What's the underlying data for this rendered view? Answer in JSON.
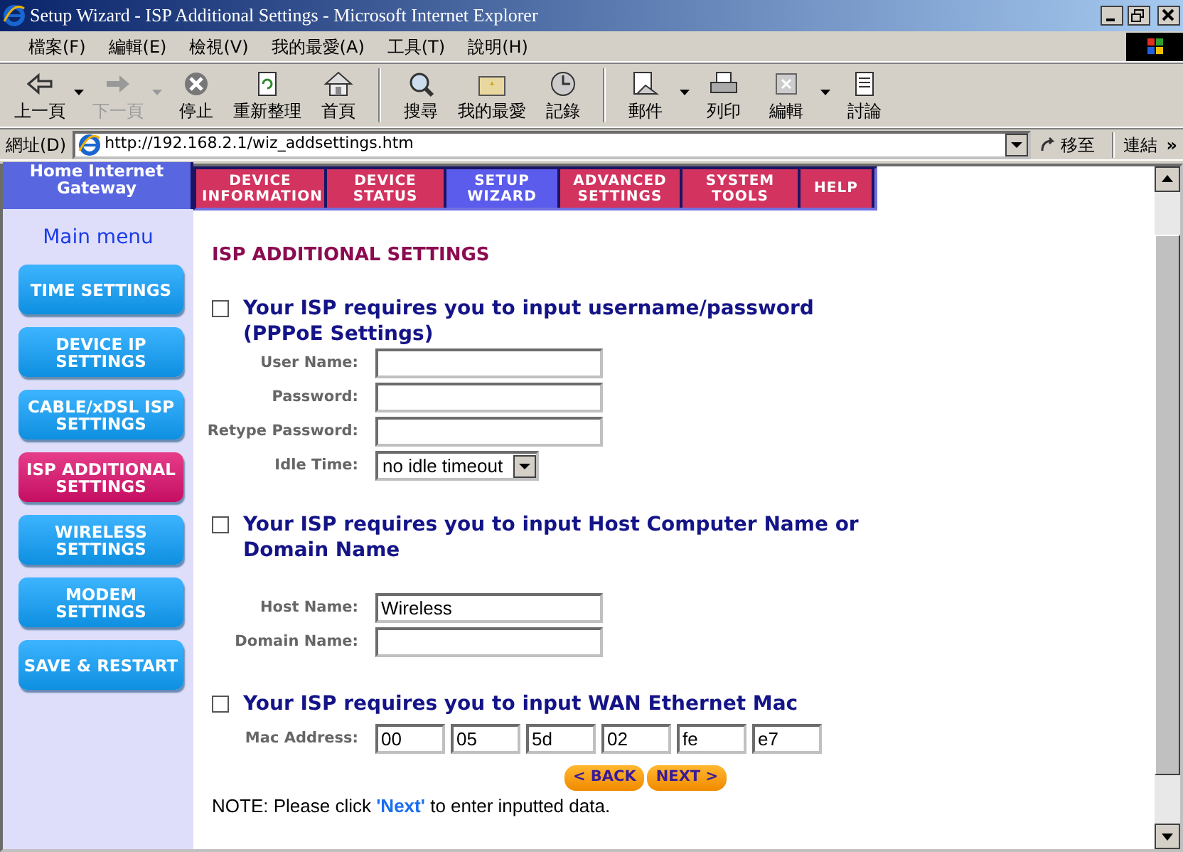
{
  "window": {
    "title": "Setup Wizard - ISP Additional Settings - Microsoft Internet Explorer"
  },
  "menu": [
    "檔案(F)",
    "編輯(E)",
    "檢視(V)",
    "我的最愛(A)",
    "工具(T)",
    "說明(H)"
  ],
  "toolbar": [
    {
      "kind": "back",
      "label": "上一頁",
      "disabled": false,
      "dropdown": true
    },
    {
      "kind": "forward",
      "label": "下一頁",
      "disabled": true,
      "dropdown": true
    },
    {
      "kind": "stop",
      "label": "停止",
      "disabled": false,
      "dropdown": false
    },
    {
      "kind": "refresh",
      "label": "重新整理",
      "disabled": false,
      "dropdown": false
    },
    {
      "kind": "home",
      "label": "首頁",
      "disabled": false,
      "dropdown": false
    },
    {
      "kind": "search",
      "label": "搜尋",
      "disabled": false,
      "dropdown": false
    },
    {
      "kind": "favorites",
      "label": "我的最愛",
      "disabled": false,
      "dropdown": false
    },
    {
      "kind": "history",
      "label": "記錄",
      "disabled": false,
      "dropdown": false
    },
    {
      "kind": "mail",
      "label": "郵件",
      "disabled": false,
      "dropdown": true
    },
    {
      "kind": "print",
      "label": "列印",
      "disabled": false,
      "dropdown": false
    },
    {
      "kind": "edit",
      "label": "編輯",
      "disabled": false,
      "dropdown": true
    },
    {
      "kind": "discuss",
      "label": "討論",
      "disabled": false,
      "dropdown": false
    }
  ],
  "address": {
    "label": "網址(D)",
    "url": "http://192.168.2.1/wiz_addsettings.htm",
    "go": "移至",
    "links": "連結",
    "more": "»"
  },
  "sidebar": {
    "brand": "Home Internet Gateway",
    "heading": "Main menu",
    "items": [
      {
        "label": "TIME SETTINGS",
        "selected": false
      },
      {
        "label": "DEVICE IP SETTINGS",
        "selected": false
      },
      {
        "label": "CABLE/xDSL ISP SETTINGS",
        "selected": false
      },
      {
        "label": "ISP ADDITIONAL SETTINGS",
        "selected": true
      },
      {
        "label": "WIRELESS SETTINGS",
        "selected": false
      },
      {
        "label": "MODEM SETTINGS",
        "selected": false
      },
      {
        "label": "SAVE & RESTART",
        "selected": false
      }
    ]
  },
  "nav_tabs": [
    {
      "label": "DEVICE INFORMATION",
      "selected": false
    },
    {
      "label": "DEVICE STATUS",
      "selected": false
    },
    {
      "label": "SETUP WIZARD",
      "selected": true
    },
    {
      "label": "ADVANCED SETTINGS",
      "selected": false
    },
    {
      "label": "SYSTEM TOOLS",
      "selected": false
    },
    {
      "label": "HELP",
      "selected": false
    }
  ],
  "page": {
    "title": "ISP ADDITIONAL SETTINGS",
    "sections": [
      {
        "checked": false,
        "heading": "Your ISP requires you to input username/password  (PPPoE Settings)",
        "fields": [
          {
            "kind": "text",
            "label": "User Name:"
          },
          {
            "kind": "text",
            "label": "Password:"
          },
          {
            "kind": "text",
            "label": "Retype Password:"
          },
          {
            "kind": "select",
            "label": "Idle Time:",
            "value": "no idle timeout"
          }
        ]
      },
      {
        "checked": false,
        "heading": "Your ISP requires you to input Host Computer Name or Domain Name",
        "fields": [
          {
            "kind": "text",
            "label": "Host Name:",
            "value": "Wireless"
          },
          {
            "kind": "text",
            "label": "Domain Name:"
          }
        ]
      },
      {
        "checked": false,
        "heading": "Your ISP requires you to input WAN Ethernet Mac",
        "fields": [
          {
            "kind": "mac",
            "label": "Mac Address:",
            "values": [
              "00",
              "05",
              "5d",
              "02",
              "fe",
              "e7"
            ]
          }
        ]
      }
    ],
    "buttons": [
      "< BACK",
      "NEXT >"
    ],
    "note": "NOTE: Please click **'Next'** to enter inputted data."
  }
}
